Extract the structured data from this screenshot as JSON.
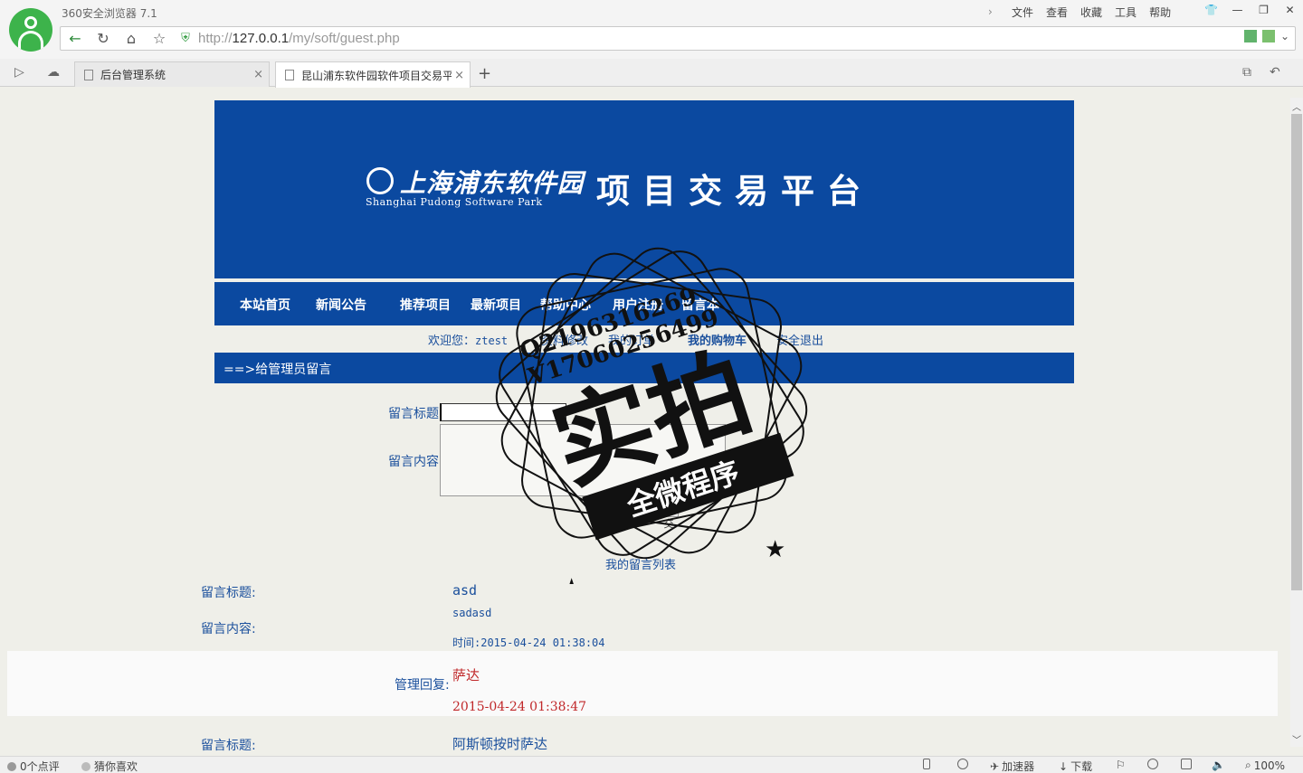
{
  "browser": {
    "app_title": "360安全浏览器 7.1",
    "menu": [
      "文件",
      "查看",
      "收藏",
      "工具",
      "帮助"
    ],
    "address": {
      "scheme": "http://",
      "host": "127.0.0.1",
      "path": "/my/soft/guest.php"
    },
    "tabs": [
      {
        "label": "后台管理系统",
        "active": false
      },
      {
        "label": "昆山浦东软件园软件项目交易平",
        "active": true
      }
    ],
    "status": {
      "comments": "0个点评",
      "guess": "猜你喜欢",
      "accelerator": "加速器",
      "download": "下载",
      "zoom": "100%"
    }
  },
  "site": {
    "logo_cn": "上海浦东软件园",
    "logo_en": "Shanghai Pudong Software Park",
    "banner_title": "项目交易平台",
    "nav": [
      "本站首页",
      "新闻公告",
      "推荐项目",
      "最新项目",
      "帮助中心",
      "用户注册",
      "留言本"
    ],
    "welcome_prefix": "欢迎您：",
    "username": "ztest",
    "user_links": [
      "资料修改",
      "我的订单",
      "我的购物车",
      "安全退出"
    ],
    "section_title": "==>给管理员留言",
    "form": {
      "title_label": "留言标题",
      "content_label": "留言内容",
      "title_value": "",
      "content_value": "",
      "submit": "提交",
      "my_list_link": "我的留言列表"
    },
    "messages": [
      {
        "title_label": "留言标题:",
        "title": "asd",
        "content_label": "留言内容:",
        "content": "sadasd",
        "time": "时间:2015-04-24 01:38:04",
        "reply_label": "管理回复:",
        "reply": "萨达",
        "reply_time": "2015-04-24 01:38:47"
      },
      {
        "title_label": "留言标题:",
        "title": "阿斯顿按时萨达"
      }
    ]
  },
  "watermark": {
    "line1": "Q2196316269",
    "line2": "V17060256499",
    "main": "实拍",
    "banner": "全微程序"
  }
}
